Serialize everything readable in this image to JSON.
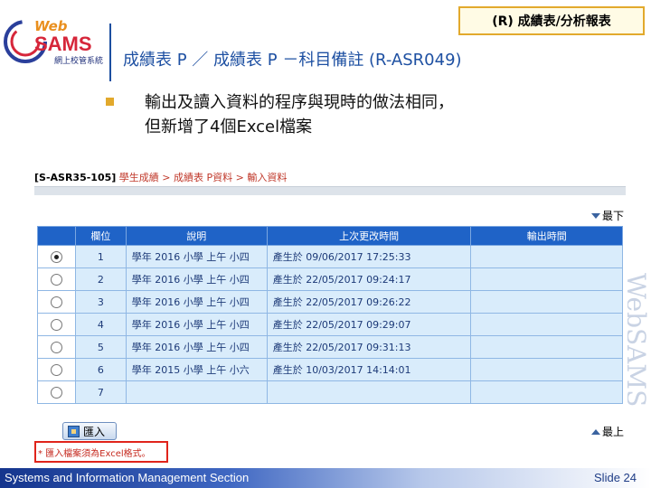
{
  "logo": {
    "line1": "Web",
    "line2": "SAMS",
    "subtitle": "網上校管系統"
  },
  "top_tag": "(R)  成績表/分析報表",
  "title": "成績表 P ／ 成績表 P －科目備註 (R-ASR049)",
  "bullet": {
    "lines": [
      "輸出及讀入資料的程序與現時的做法相同，",
      "但新增了4個Excel檔案"
    ]
  },
  "screenshot": {
    "breadcrumb": {
      "id": "[S-ASR35-105]",
      "path": "學生成績 > 成績表 P資料 > 輸入資料"
    },
    "link_bottom": "最下",
    "link_top": "最上",
    "import_button": "匯入",
    "headers": [
      "欄位",
      "說明",
      "上次更改時間",
      "輸出時間"
    ],
    "rows": [
      {
        "selected": true,
        "no": "1",
        "desc": "學年 2016 小學 上午 小四",
        "time": "產生於   09/06/2017 17:25:33",
        "out": ""
      },
      {
        "selected": false,
        "no": "2",
        "desc": "學年 2016 小學 上午 小四",
        "time": "產生於   22/05/2017 09:24:17",
        "out": ""
      },
      {
        "selected": false,
        "no": "3",
        "desc": "學年 2016 小學 上午 小四",
        "time": "產生於   22/05/2017 09:26:22",
        "out": ""
      },
      {
        "selected": false,
        "no": "4",
        "desc": "學年 2016 小學 上午 小四",
        "time": "產生於   22/05/2017 09:29:07",
        "out": ""
      },
      {
        "selected": false,
        "no": "5",
        "desc": "學年 2016 小學 上午 小四",
        "time": "產生於   22/05/2017 09:31:13",
        "out": ""
      },
      {
        "selected": false,
        "no": "6",
        "desc": "學年 2015 小學 上午 小六",
        "time": "產生於   10/03/2017 14:14:01",
        "out": ""
      },
      {
        "selected": false,
        "no": "7",
        "desc": "",
        "time": "",
        "out": ""
      }
    ],
    "note": "* 匯入檔案須為Excel格式。"
  },
  "watermark": "WebSAMS",
  "footer": {
    "left": "Systems and Information Management Section",
    "right": "Slide 24"
  },
  "colors": {
    "title": "#1e50a2",
    "bullet_accent": "#e2a92c",
    "grid_header": "#1f63c7",
    "grid_cell": "#d9ecfb",
    "footer_dark": "#15358d",
    "note_border": "#e0241b"
  }
}
